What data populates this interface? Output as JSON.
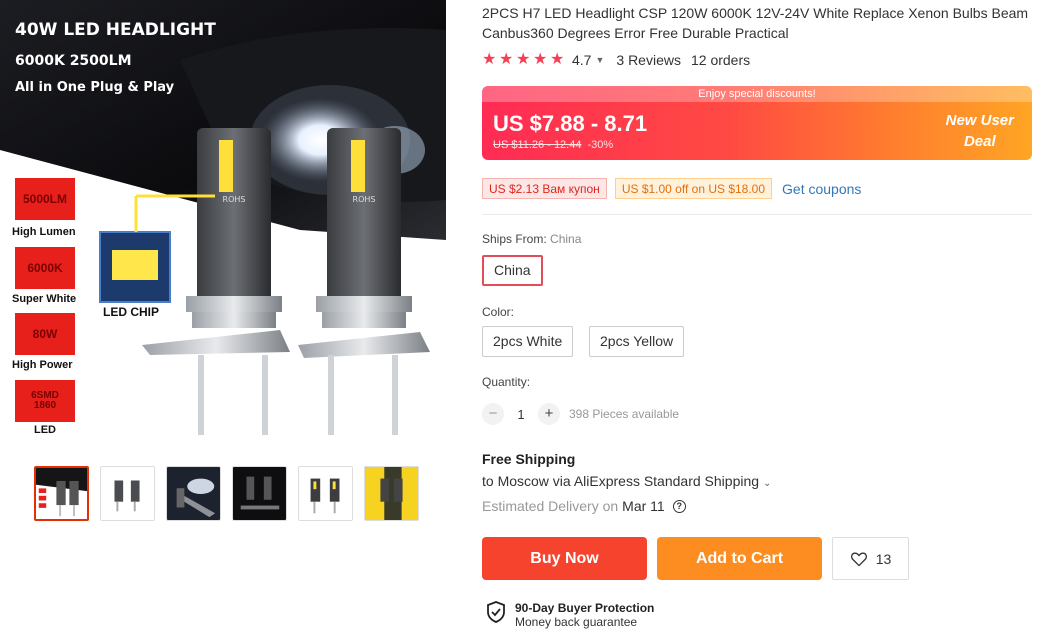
{
  "image_text": {
    "headline": "40W LED HEADLIGHT",
    "spec_line": "6000K  2500LM",
    "tagline": "All in One Plug & Play",
    "specs": [
      {
        "value": "5000LM",
        "label": "High Lumen"
      },
      {
        "value": "6000K",
        "label": "Super White"
      },
      {
        "value": "80W",
        "label": "High Power"
      },
      {
        "value": "6SMD 1860",
        "label": "LED"
      }
    ],
    "chip_label": "LED CHIP",
    "bulb_mark": "ROHS"
  },
  "product": {
    "title": "2PCS H7 LED Headlight CSP 120W 6000K 12V-24V White Replace Xenon Bulbs Beam Canbus360 Degrees Error Free Durable Practical",
    "rating": "4.7",
    "reviews": "3 Reviews",
    "orders": "12 orders"
  },
  "price": {
    "promo_strip": "Enjoy special discounts!",
    "current": "US $7.88 - 8.71",
    "original": "US $11.26 - 12.44",
    "discount": "-30%",
    "new_user_line1": "New User",
    "new_user_line2": "Deal"
  },
  "coupons": {
    "coupon1": "US $2.13 Вам купон",
    "coupon2": "US $1.00 off on US $18.00",
    "get_coupons": "Get coupons"
  },
  "ships_from": {
    "label": "Ships From:",
    "value": "China",
    "options": [
      "China"
    ]
  },
  "color": {
    "label": "Color:",
    "options": [
      "2pcs White",
      "2pcs Yellow"
    ]
  },
  "quantity": {
    "label": "Quantity:",
    "value": "1",
    "minus": "−",
    "plus": "+",
    "available": "398 Pieces available"
  },
  "shipping": {
    "title": "Free Shipping",
    "route": "to Moscow via AliExpress Standard Shipping",
    "estimated_label": "Estimated Delivery on",
    "estimated_date": "Mar 11",
    "help": "?"
  },
  "actions": {
    "buy_now": "Buy Now",
    "add_to_cart": "Add to Cart",
    "wishlist_count": "13"
  },
  "protection": {
    "title": "90-Day Buyer Protection",
    "subtitle": "Money back guarantee"
  },
  "colors": {
    "accent_red": "#f5432e",
    "accent_orange": "#fd8c21",
    "star": "#f44054",
    "link": "#3278b9"
  }
}
